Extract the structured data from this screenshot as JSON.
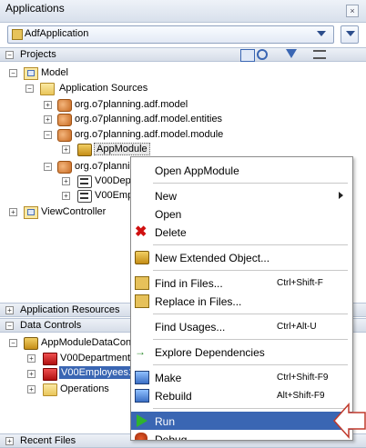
{
  "window": {
    "title": "Applications"
  },
  "app_selector": {
    "value": "AdfApplication"
  },
  "projects_panel": {
    "title": "Projects"
  },
  "tree": {
    "model": "Model",
    "app_sources": "Application Sources",
    "pkg1": "org.o7planning.adf.model",
    "pkg2": "org.o7planning.adf.model.entities",
    "pkg3": "org.o7planning.adf.model.module",
    "appmodule": "AppModule",
    "pkg4": "org.o7plannin",
    "vo1": "V00Dep",
    "vo2": "V00Emp",
    "viewcontroller": "ViewController"
  },
  "app_resources": {
    "title": "Application Resources"
  },
  "data_controls": {
    "title": "Data Controls",
    "root": "AppModuleDataCon",
    "dept": "V00Department",
    "emp": "V00Employees1",
    "ops": "Operations"
  },
  "recent_files": {
    "title": "Recent Files"
  },
  "context_menu": {
    "open_appmodule": "Open AppModule",
    "new": "New",
    "open": "Open",
    "delete": "Delete",
    "new_extended": "New Extended Object...",
    "find_in_files": "Find in Files...",
    "find_in_files_sc": "Ctrl+Shift-F",
    "replace_in_files": "Replace in Files...",
    "find_usages": "Find Usages...",
    "find_usages_sc": "Ctrl+Alt-U",
    "explore_deps": "Explore Dependencies",
    "make": "Make",
    "make_sc": "Ctrl+Shift-F9",
    "rebuild": "Rebuild",
    "rebuild_sc": "Alt+Shift-F9",
    "run": "Run",
    "debug": "Debug"
  },
  "colors": {
    "selection": "#3a66b3",
    "callout_fill": "#ffffff",
    "callout_border": "#c0392b"
  }
}
